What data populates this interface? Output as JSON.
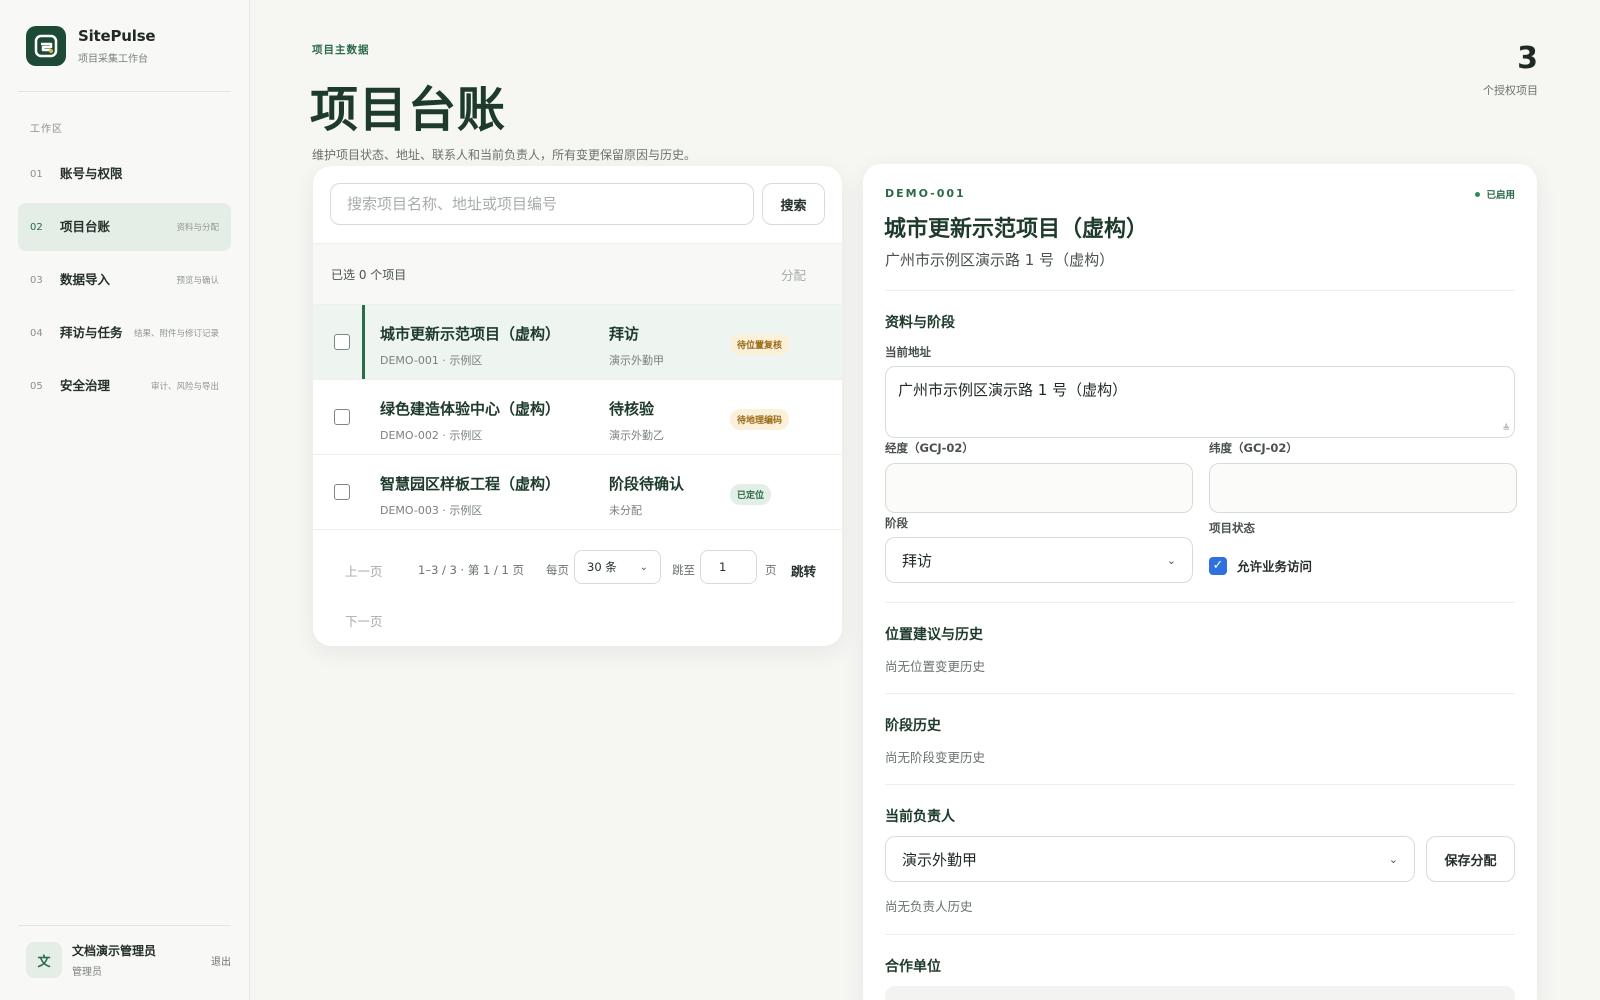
{
  "app": {
    "name": "SitePulse",
    "subtitle": "项目采集工作台",
    "section_label": "工作区"
  },
  "nav": [
    {
      "num": "01",
      "label": "账号与权限",
      "desc": "",
      "active": false
    },
    {
      "num": "02",
      "label": "项目台账",
      "desc": "资料与分配",
      "active": true
    },
    {
      "num": "03",
      "label": "数据导入",
      "desc": "预览与确认",
      "active": false
    },
    {
      "num": "04",
      "label": "拜访与任务",
      "desc": "结果、附件与修订记录",
      "active": false
    },
    {
      "num": "05",
      "label": "安全治理",
      "desc": "审计、风险与导出",
      "active": false
    }
  ],
  "user": {
    "avatar": "文",
    "name": "文档演示管理员",
    "role": "管理员",
    "logout": "退出"
  },
  "header": {
    "eyebrow": "项目主数据",
    "title": "项目台账",
    "description": "维护项目状态、地址、联系人和当前负责人，所有变更保留原因与历史。",
    "count": "3",
    "count_label": "个授权项目"
  },
  "list": {
    "search_placeholder": "搜索项目名称、地址或项目编号",
    "search_button": "搜索",
    "selected_text": "已选 0 个项目",
    "assign_button": "分配",
    "rows": [
      {
        "name": "城市更新示范项目（虚构）",
        "meta": "DEMO-001 · 示例区",
        "stage": "拜访",
        "owner": "演示外勤甲",
        "badge": "待位置复核",
        "badge_type": "warn",
        "selected": true
      },
      {
        "name": "绿色建造体验中心（虚构）",
        "meta": "DEMO-002 · 示例区",
        "stage": "待核验",
        "owner": "演示外勤乙",
        "badge": "待地理编码",
        "badge_type": "warn",
        "selected": false
      },
      {
        "name": "智慧园区样板工程（虚构）",
        "meta": "DEMO-003 · 示例区",
        "stage": "阶段待确认",
        "owner": "未分配",
        "badge": "已定位",
        "badge_type": "ok",
        "selected": false
      }
    ],
    "pager": {
      "prev": "上一页",
      "info": "1–3 / 3 · 第 1 / 1 页",
      "per_page_label": "每页",
      "per_page_value": "30 条",
      "jump_label": "跳至",
      "jump_value": "1",
      "page_unit": "页",
      "go": "跳转",
      "next": "下一页"
    }
  },
  "detail": {
    "code": "DEMO-001",
    "status": "已启用",
    "title": "城市更新示范项目（虚构）",
    "address": "广州市示例区演示路 1 号（虚构）",
    "section_profile": "资料与阶段",
    "label_address": "当前地址",
    "address_value": "广州市示例区演示路 1 号（虚构）",
    "label_lng": "经度（GCJ-02）",
    "label_lat": "纬度（GCJ-02）",
    "lng_value": "",
    "lat_value": "",
    "label_stage": "阶段",
    "stage_value": "拜访",
    "label_project_status": "项目状态",
    "allow_access_label": "允许业务访问",
    "allow_access_checked": true,
    "section_location": "位置建议与历史",
    "location_empty": "尚无位置变更历史",
    "section_stage_history": "阶段历史",
    "stage_history_empty": "尚无阶段变更历史",
    "section_owner": "当前负责人",
    "owner_value": "演示外勤甲",
    "save_assign": "保存分配",
    "owner_history_empty": "尚无负责人历史",
    "section_partner": "合作单位"
  },
  "colors": {
    "accent": "#2d6a4a",
    "title": "#1d3a2b",
    "warn_bg": "#fbf1db",
    "warn_fg": "#9b6a16",
    "checkbox": "#2f6fde"
  },
  "icons": {
    "brand": "sitepulse-logo-icon",
    "select": "chevron-down-icon",
    "status": "status-dot-icon",
    "check": "checkmark-icon"
  }
}
